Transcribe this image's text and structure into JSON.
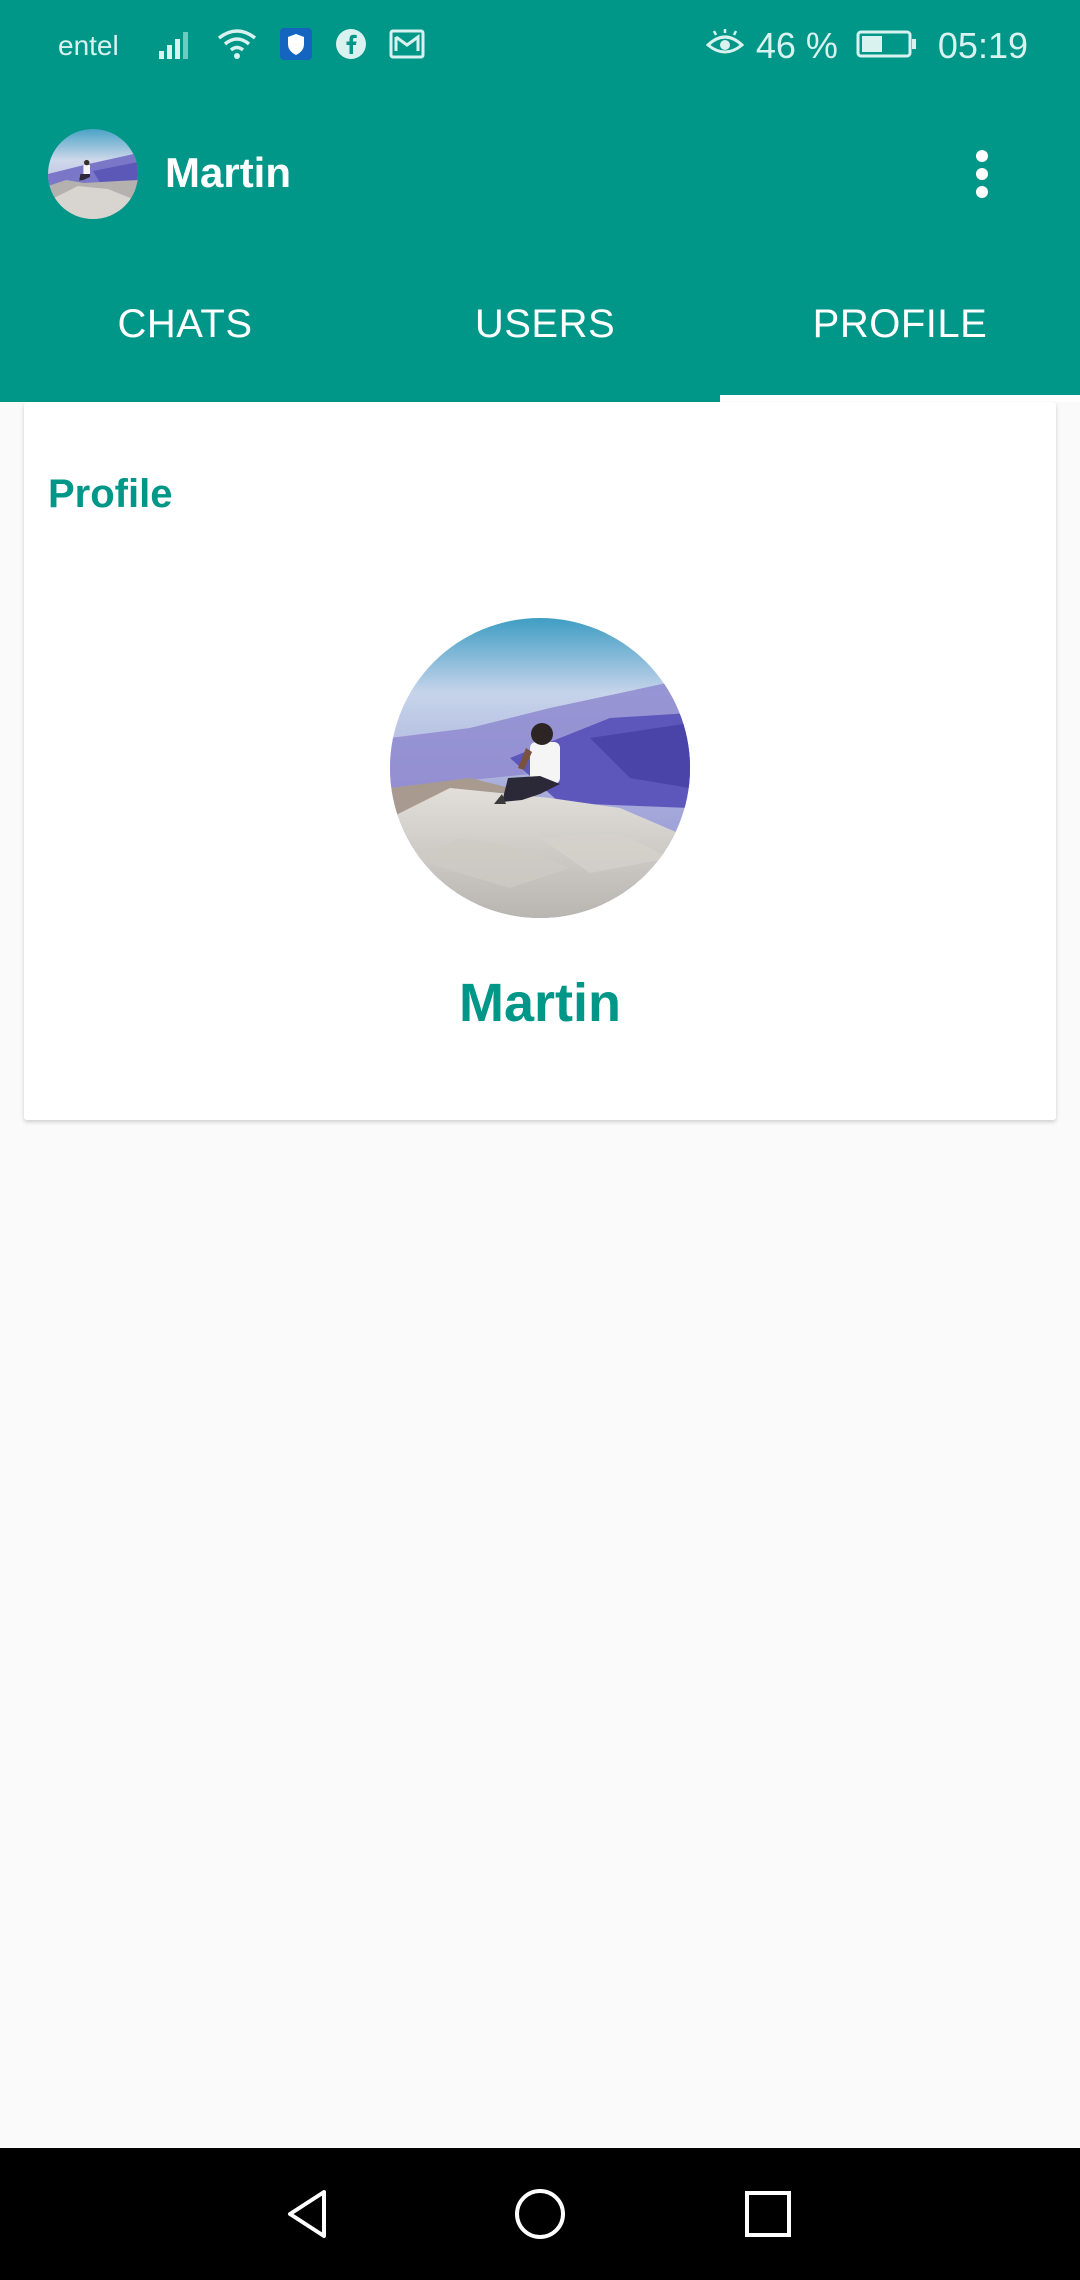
{
  "status_bar": {
    "carrier": "entel",
    "battery_percent": "46 %",
    "time": "05:19",
    "battery_level": 0.46,
    "icons": [
      "signal-icon",
      "wifi-icon",
      "shield-icon",
      "facebook-icon",
      "email-icon",
      "eye-icon",
      "battery-icon"
    ]
  },
  "app_bar": {
    "title": "Martin",
    "menu_icon": "more-vert-icon"
  },
  "tabs": [
    {
      "label": "CHATS",
      "active": false
    },
    {
      "label": "USERS",
      "active": false
    },
    {
      "label": "PROFILE",
      "active": true
    }
  ],
  "profile": {
    "section_title": "Profile",
    "name": "Martin"
  },
  "nav_bar": {
    "icons": [
      "back-icon",
      "home-icon",
      "recents-icon"
    ]
  },
  "colors": {
    "primary": "#009688",
    "accent_text": "#009688",
    "background": "#fafafa",
    "card": "#ffffff"
  }
}
